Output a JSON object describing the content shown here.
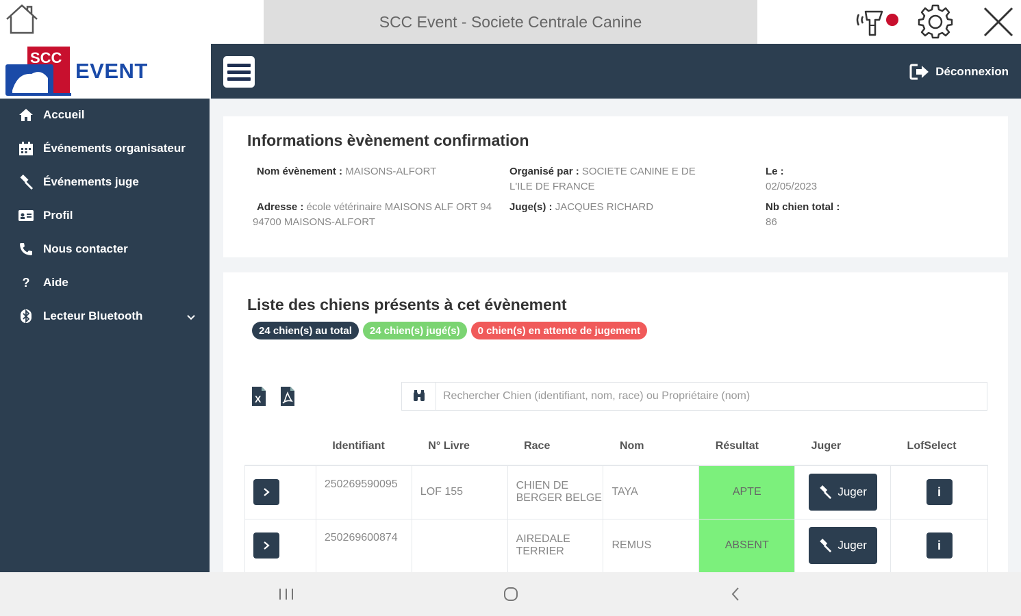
{
  "topbar": {
    "title": "SCC Event - Societe Centrale Canine"
  },
  "logo": {
    "badge_text": "SCC",
    "text": "EVENT"
  },
  "header": {
    "logout_label": "Déconnexion"
  },
  "sidebar": {
    "items": [
      {
        "label": "Accueil",
        "icon": "home-icon"
      },
      {
        "label": "Événements organisateur",
        "icon": "calendar-icon"
      },
      {
        "label": "Événements juge",
        "icon": "gavel-icon"
      },
      {
        "label": "Profil",
        "icon": "id-card-icon"
      },
      {
        "label": "Nous contacter",
        "icon": "phone-icon"
      },
      {
        "label": "Aide",
        "icon": "question-icon"
      },
      {
        "label": "Lecteur Bluetooth",
        "icon": "bluetooth-icon"
      }
    ]
  },
  "event_info": {
    "title": "Informations èvènement confirmation",
    "name_label": "Nom évènement :",
    "name_value": "MAISONS-ALFORT",
    "address_label": "Adresse :",
    "address_value": "école vétérinaire MAISONS ALF ORT 94 94700 MAISONS-ALFORT",
    "organizer_label": "Organisé par :",
    "organizer_value": "SOCIETE CANINE E DE L'ILE DE FRANCE",
    "judge_label": "Juge(s) :",
    "judge_value": "JACQUES RICHARD",
    "date_label": "Le :",
    "date_value": "02/05/2023",
    "total_label": "Nb chien total :",
    "total_value": "86"
  },
  "dogs": {
    "title": "Liste des chiens présents à cet évènement",
    "badge_total": "24 chien(s) au total",
    "badge_judged": "24 chien(s) jugé(s)",
    "badge_pending": "0 chien(s) en attente de jugement",
    "search_placeholder": "Rechercher Chien (identifiant, nom, race) ou Propriétaire (nom)",
    "columns": [
      "Identifiant",
      "N° Livre",
      "Race",
      "Nom",
      "Résultat",
      "Juger",
      "LofSelect"
    ],
    "judge_button_label": "Juger",
    "info_button_label": "i",
    "rows": [
      {
        "id": "250269590095",
        "book": "LOF 155",
        "race": "CHIEN DE BERGER BELGE",
        "name": "TAYA",
        "result": "APTE"
      },
      {
        "id": "250269600874",
        "book": "",
        "race": "AIREDALE TERRIER",
        "name": "REMUS",
        "result": "ABSENT"
      }
    ]
  },
  "colors": {
    "dark": "#2c3e50",
    "accent_green": "#7cf07c",
    "badge_green": "#7bd472",
    "badge_red": "#f05a5a",
    "recording": "#c8102e"
  }
}
